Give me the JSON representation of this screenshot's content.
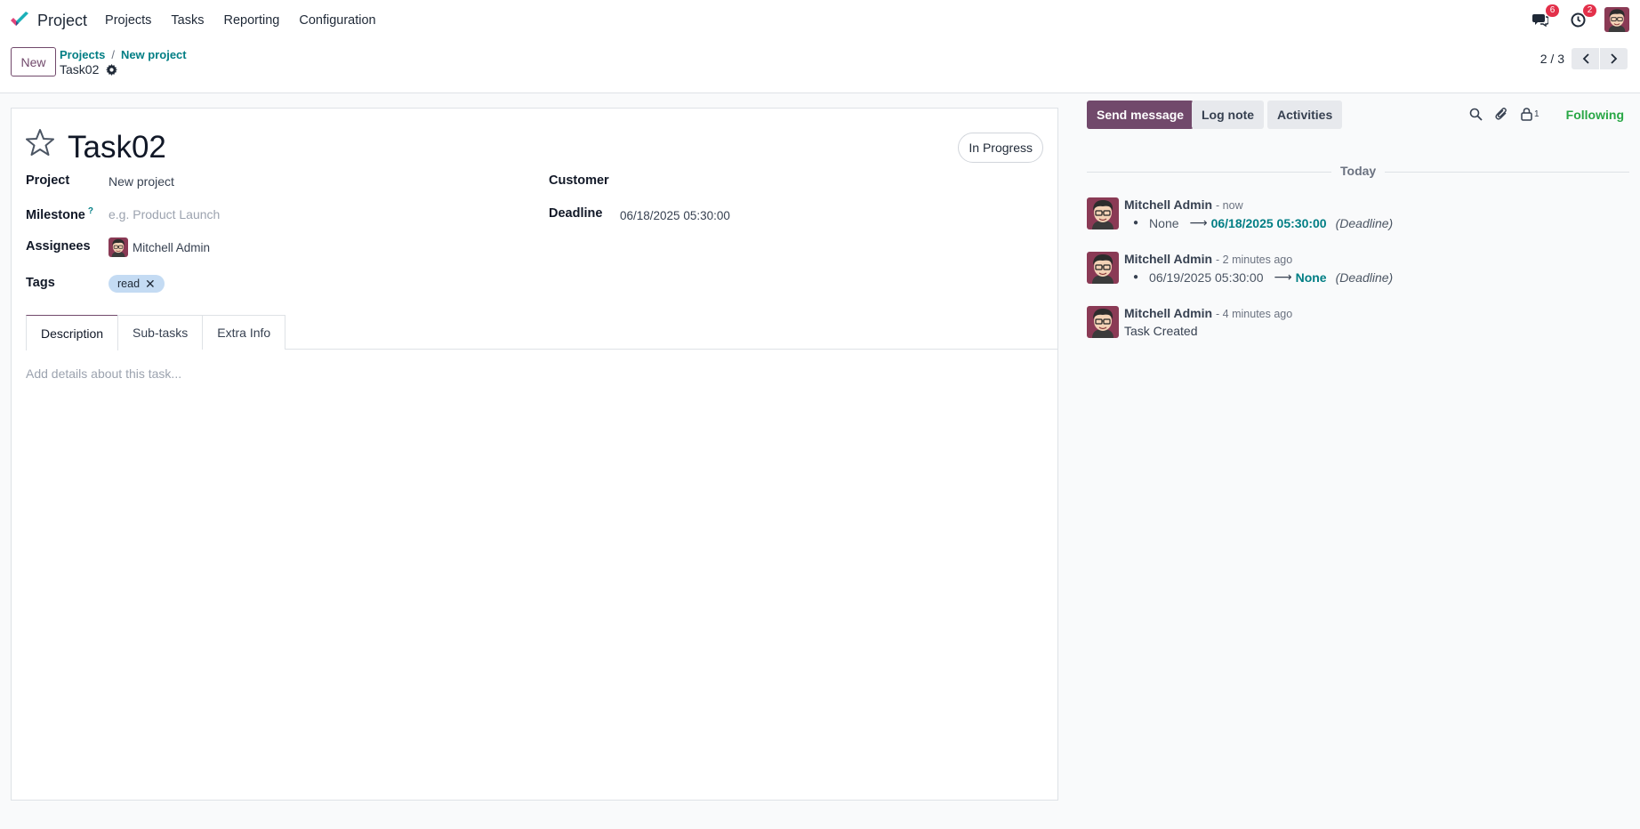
{
  "nav": {
    "app_name": "Project",
    "menu": [
      "Projects",
      "Tasks",
      "Reporting",
      "Configuration"
    ],
    "messages_badge": "6",
    "activities_badge": "2"
  },
  "control_panel": {
    "new_label": "New",
    "breadcrumb": [
      "Projects",
      "New project"
    ],
    "breadcrumb_sep": "/",
    "current": "Task02",
    "pager": "2 / 3"
  },
  "form": {
    "title": "Task02",
    "stage": "In Progress",
    "fields": {
      "project_label": "Project",
      "project_value": "New project",
      "customer_label": "Customer",
      "milestone_label": "Milestone",
      "milestone_help": "?",
      "milestone_placeholder": "e.g. Product Launch",
      "deadline_label": "Deadline",
      "deadline_value": "06/18/2025 05:30:00",
      "assignees_label": "Assignees",
      "assignee_name": "Mitchell Admin",
      "tags_label": "Tags",
      "tag": "read"
    },
    "tabs": [
      "Description",
      "Sub-tasks",
      "Extra Info"
    ],
    "description_placeholder": "Add details about this task..."
  },
  "chatter": {
    "send_message": "Send message",
    "log_note": "Log note",
    "activities": "Activities",
    "followers_count": "1",
    "following": "Following",
    "day_label": "Today",
    "messages": [
      {
        "author": "Mitchell Admin",
        "date": "- now",
        "old": "None",
        "new": "06/18/2025 05:30:00",
        "field": "(Deadline)"
      },
      {
        "author": "Mitchell Admin",
        "date": "- 2 minutes ago",
        "old": "06/19/2025 05:30:00",
        "new": "None",
        "field": "(Deadline)"
      },
      {
        "author": "Mitchell Admin",
        "date": "- 4 minutes ago",
        "text": "Task Created"
      }
    ]
  },
  "colors": {
    "primary": "#71496b",
    "link": "#017e84",
    "following": "#28a745",
    "badge": "#e3304a",
    "tag_bg": "#c4dbf3"
  }
}
